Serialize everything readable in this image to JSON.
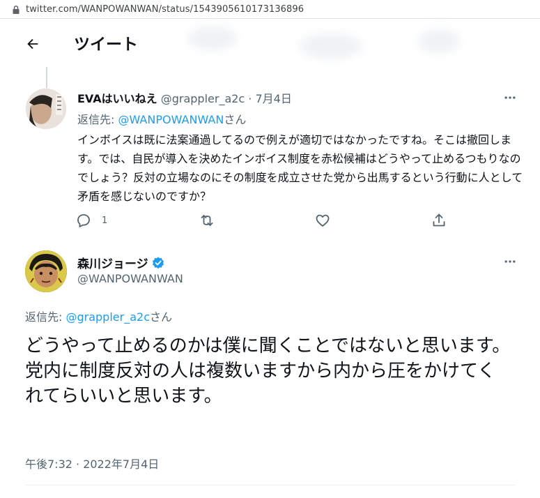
{
  "browser": {
    "url": "twitter.com/WANPOWANWAN/status/1543905610173136896"
  },
  "header": {
    "title": "ツイート"
  },
  "reply_tweet": {
    "display_name": "EVAはいいねえ",
    "handle": "@grappler_a2c",
    "separator": " · ",
    "date": "7月4日",
    "reply_prefix": "返信先: ",
    "reply_mention": "@WANPOWANWAN",
    "reply_suffix": "さん",
    "text": "インボイスは既に法案通過してるので例えが適切ではなかったですね。そこは撤回します。では、自民が導入を決めたインボイス制度を赤松候補はどうやって止めるつもりなのでしょう？反対の立場なのにその制度を成立させた党から出馬するという行動に人として矛盾を感じないのですか？",
    "reply_count": "1"
  },
  "main_tweet": {
    "display_name": "森川ジョージ",
    "handle": "@WANPOWANWAN",
    "reply_prefix": "返信先: ",
    "reply_mention": "@grappler_a2c",
    "reply_suffix": "さん",
    "text_line1": "どうやって止めるのかは僕に聞くことではないと思います。",
    "text_line2": "党内に制度反対の人は複数いますから内から圧をかけてくれてらいいと思います。",
    "timestamp": "午後7:32 · 2022年7月4日"
  },
  "icons": {
    "lock": "lock-icon",
    "back": "arrow-left-icon",
    "more": "more-horizontal-icon",
    "reply": "reply-icon",
    "retweet": "retweet-icon",
    "like": "heart-icon",
    "share": "share-icon",
    "verified": "verified-badge-icon"
  },
  "colors": {
    "accent": "#1d9bf0",
    "text": "#0f1419",
    "muted": "#536471"
  }
}
